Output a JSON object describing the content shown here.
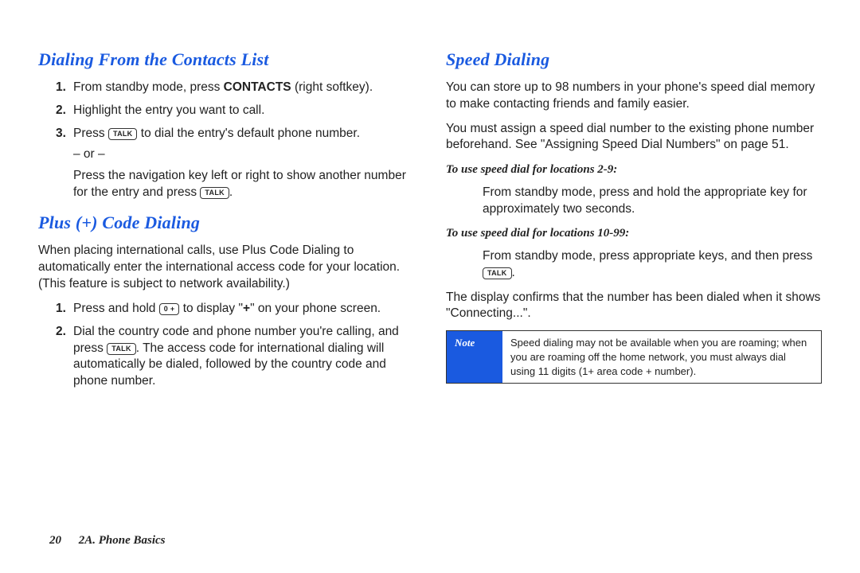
{
  "left": {
    "h_contacts": "Dialing From the Contacts List",
    "contacts_steps": {
      "s1_pre": "From standby mode, press ",
      "s1_bold": "CONTACTS",
      "s1_post": " (right softkey).",
      "s2": "Highlight the entry you want to call.",
      "s3_pre": "Press ",
      "s3_key": "TALK",
      "s3_post": " to dial the entry's default phone number.",
      "or": "– or –",
      "s3b_pre": "Press the navigation key left or right to show another number for the entry and press ",
      "s3b_key": "TALK",
      "s3b_post": "."
    },
    "h_plus": "Plus (+) Code Dialing",
    "plus_intro": "When placing international calls, use Plus Code Dialing to automatically enter the international access code for your location. (This feature is subject to network availability.)",
    "plus_steps": {
      "s1_pre": "Press and hold ",
      "s1_key": "0 +",
      "s1_mid": " to display \"",
      "s1_bold": "+",
      "s1_post": "\" on your phone screen.",
      "s2_pre": "Dial the country code and phone number you're calling, and press ",
      "s2_key": "TALK",
      "s2_post": ". The access code for international dialing will automatically be dialed, followed by the country code and phone number."
    }
  },
  "right": {
    "h_speed": "Speed Dialing",
    "p1": "You can store up to 98 numbers in your phone's speed dial memory to make contacting friends and family easier.",
    "p2": "You must assign a speed dial number to the existing phone number beforehand. See \"Assigning Speed Dial Numbers\" on page 51.",
    "sub1": "To use speed dial for locations 2-9:",
    "sub1_body": "From standby mode, press and hold the appropriate key for approximately two seconds.",
    "sub2": "To use speed dial for locations 10-99:",
    "sub2_pre": "From standby mode, press appropriate keys, and then press ",
    "sub2_key": "TALK",
    "sub2_post": ".",
    "p3": "The display confirms that the number has been dialed when it shows \"Connecting...\".",
    "note_label": "Note",
    "note_text": "Speed dialing may not be available when you are roaming; when you are roaming off the home network, you must always dial using 11 digits (1+ area code + number)."
  },
  "footer": {
    "page": "20",
    "section": "2A. Phone Basics"
  }
}
